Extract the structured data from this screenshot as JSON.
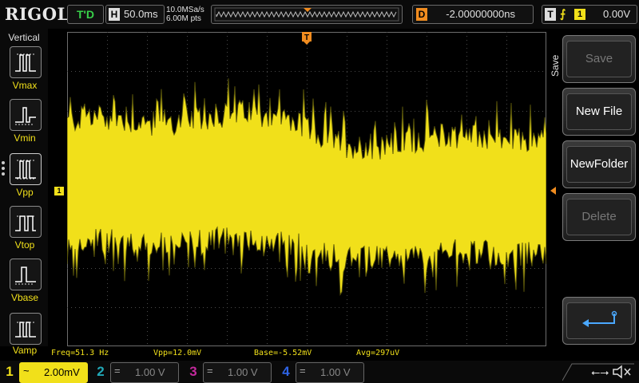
{
  "brand": "RIGOL",
  "status": {
    "trigger_state": "T'D",
    "horizontal_tag": "H",
    "timebase": "50.0ms",
    "sample_rate": "10.0MSa/s",
    "memory_depth": "6.00M pts",
    "delay_tag": "D",
    "delay": "-2.00000000ns",
    "trigger_tag": "T",
    "trigger_source": "1",
    "trigger_level": "0.00V"
  },
  "measure_panel": {
    "title": "Vertical",
    "items": [
      {
        "label": "Vmax",
        "icon": "vmax-icon"
      },
      {
        "label": "Vmin",
        "icon": "vmin-icon"
      },
      {
        "label": "Vpp",
        "icon": "vpp-icon"
      },
      {
        "label": "Vtop",
        "icon": "vtop-icon"
      },
      {
        "label": "Vbase",
        "icon": "vbase-icon"
      },
      {
        "label": "Vamp",
        "icon": "vamp-icon"
      }
    ]
  },
  "markers": {
    "channel": "1",
    "trigger_position": "T"
  },
  "measurements": [
    {
      "text": "Freq=51.3 Hz"
    },
    {
      "text": "Vpp=12.0mV"
    },
    {
      "text": "Base=-5.52mV"
    },
    {
      "text": "Avg=297uV"
    }
  ],
  "menu": {
    "title": "Save",
    "keys": [
      {
        "label": "Save",
        "enabled": false
      },
      {
        "label": "New File",
        "enabled": true
      },
      {
        "label": "NewFolder",
        "enabled": true
      },
      {
        "label": "Delete",
        "enabled": false
      },
      {
        "label": "",
        "enabled": true,
        "icon": "return-icon"
      }
    ]
  },
  "channels": [
    {
      "number": "1",
      "coupling": "~",
      "scale": "2.00mV",
      "active": true
    },
    {
      "number": "2",
      "coupling": "=",
      "scale": "1.00 V",
      "active": false
    },
    {
      "number": "3",
      "coupling": "=",
      "scale": "1.00 V",
      "active": false
    },
    {
      "number": "4",
      "coupling": "=",
      "scale": "1.00 V",
      "active": false
    }
  ],
  "colors": {
    "ch1": "#f1e01a",
    "ch2": "#22a9b8",
    "ch3": "#c4299d",
    "ch4": "#2e64e6",
    "trigger": "#f18c1f",
    "trigger_state": "#39d24a"
  }
}
